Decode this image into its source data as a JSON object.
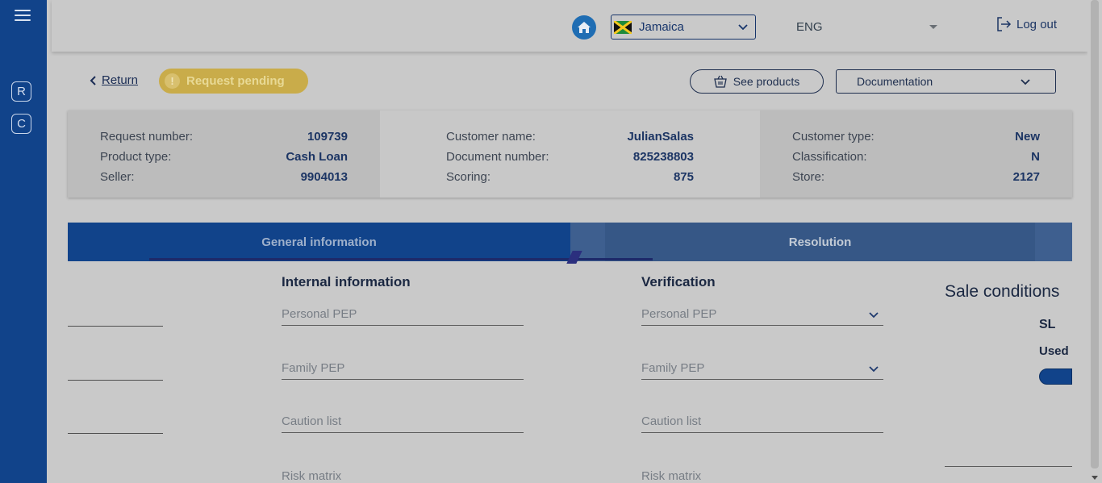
{
  "sidebar": {
    "badges": [
      "R",
      "C"
    ]
  },
  "topbar": {
    "country": "Jamaica",
    "language": "ENG",
    "logout_label": "Log out"
  },
  "actions": {
    "return_label": "Return",
    "status_label": "Request pending",
    "see_products_label": "See products",
    "documentation_label": "Documentation"
  },
  "summary": {
    "col1": [
      {
        "label": "Request number:",
        "value": "109739"
      },
      {
        "label": "Product type:",
        "value": "Cash Loan"
      },
      {
        "label": "Seller:",
        "value": "9904013"
      }
    ],
    "col2": [
      {
        "label": "Customer name:",
        "value": "JulianSalas"
      },
      {
        "label": "Document number:",
        "value": "825238803"
      },
      {
        "label": "Scoring:",
        "value": "875"
      }
    ],
    "col3": [
      {
        "label": "Customer type:",
        "value": "New"
      },
      {
        "label": "Classification:",
        "value": "N"
      },
      {
        "label": "Store:",
        "value": "2127"
      }
    ]
  },
  "tabs": {
    "general": "General information",
    "resolution": "Resolution"
  },
  "internal": {
    "title": "Internal information",
    "fields": [
      "Personal PEP",
      "Family PEP",
      "Caution list",
      "Risk matrix"
    ]
  },
  "verification": {
    "title": "Verification",
    "fields": [
      "Personal PEP",
      "Family PEP",
      "Caution list",
      "Risk matrix"
    ]
  },
  "sale": {
    "title": "Sale conditions",
    "sl": "SL",
    "used": "Used"
  },
  "colors": {
    "primary": "#11438a",
    "pending": "#c9ac4a",
    "background": "#c9c9c9"
  }
}
